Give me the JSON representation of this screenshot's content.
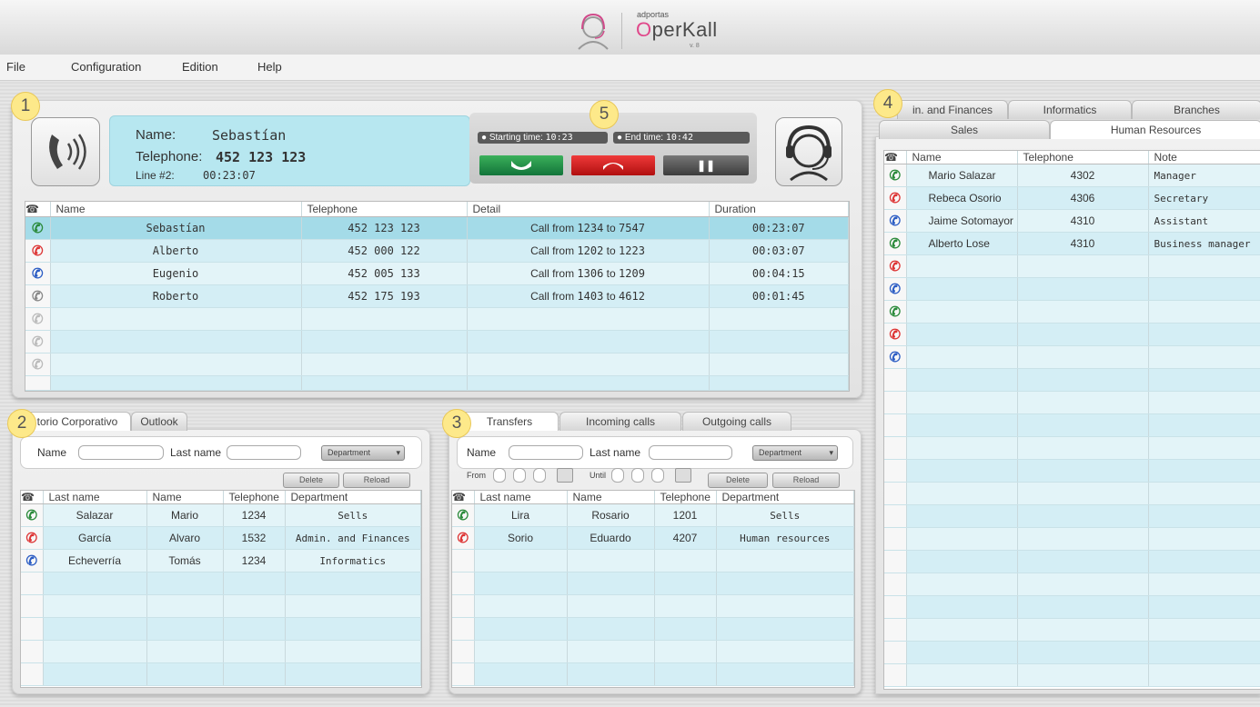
{
  "header": {
    "brand_small": "adportas",
    "brand_first": "O",
    "brand_rest": "perKall",
    "version": "v. 8"
  },
  "menu": [
    "File",
    "Configuration",
    "Edition",
    "Help"
  ],
  "badges": [
    "1",
    "2",
    "3",
    "4",
    "5"
  ],
  "call": {
    "name_label": "Name:",
    "name_value": "Sebastían",
    "phone_label": "Telephone:",
    "phone_value": "452 123 123",
    "line_label": "Line #2:",
    "line_time": "00:23:07",
    "start_label": "Starting time:",
    "start_value": "10:23",
    "end_label": "End time:",
    "end_value": "10:42"
  },
  "calls_table": {
    "headers": [
      "Name",
      "Telephone",
      "Detail",
      "Duration"
    ],
    "rows": [
      {
        "icon": "incoming-call-icon",
        "name": "Sebastían",
        "phone": "452 123 123",
        "detail": "Call from",
        "from": "1234",
        "to_label": "to",
        "to": "7547",
        "duration": "00:23:07"
      },
      {
        "icon": "outgoing-call-icon",
        "name": "Alberto",
        "phone": "452 000 122",
        "detail": "Call from",
        "from": "1202",
        "to_label": "to",
        "to": "1223",
        "duration": "00:03:07"
      },
      {
        "icon": "transfer-call-icon",
        "name": "Eugenio",
        "phone": "452 005 133",
        "detail": "Call from",
        "from": "1306",
        "to_label": "to",
        "to": "1209",
        "duration": "00:04:15"
      },
      {
        "icon": "hold-call-icon",
        "name": "Roberto",
        "phone": "452 175 193",
        "detail": "Call from",
        "from": "1403",
        "to_label": "to",
        "to": "4612",
        "duration": "00:01:45"
      }
    ]
  },
  "directory": {
    "tabs": [
      "torio Corporativo",
      "Outlook"
    ],
    "name_label": "Name",
    "lastname_label": "Last name",
    "department_label": "Department",
    "delete_label": "Delete",
    "reload_label": "Reload",
    "headers": [
      "Last name",
      "Name",
      "Telephone",
      "Department"
    ],
    "rows": [
      {
        "icon": "incoming-call-icon",
        "last": "Salazar",
        "name": "Mario",
        "phone": "1234",
        "dept": "Sells"
      },
      {
        "icon": "outgoing-call-icon",
        "last": "García",
        "name": "Alvaro",
        "phone": "1532",
        "dept": "Admin. and Finances"
      },
      {
        "icon": "transfer-call-icon",
        "last": "Echeverría",
        "name": "Tomás",
        "phone": "1234",
        "dept": "Informatics"
      }
    ]
  },
  "history": {
    "tabs": [
      "Transfers",
      "Incoming calls",
      "Outgoing calls"
    ],
    "name_label": "Name",
    "lastname_label": "Last name",
    "department_label": "Department",
    "from_label": "From",
    "until_label": "Until",
    "delete_label": "Delete",
    "reload_label": "Reload",
    "headers": [
      "Last name",
      "Name",
      "Telephone",
      "Department"
    ],
    "rows": [
      {
        "icon": "incoming-call-icon",
        "last": "Lira",
        "name": "Rosario",
        "phone": "1201",
        "dept": "Sells"
      },
      {
        "icon": "outgoing-call-icon",
        "last": "Sorio",
        "name": "Eduardo",
        "phone": "4207",
        "dept": "Human resources"
      }
    ]
  },
  "departments": {
    "tabs_back": [
      "in. and Finances",
      "Informatics",
      "Branches"
    ],
    "tabs_front": [
      "Sales",
      "Human Resources"
    ],
    "headers": [
      "Name",
      "Telephone",
      "Note"
    ],
    "rows": [
      {
        "icon": "incoming-call-icon",
        "name": "Mario Salazar",
        "phone": "4302",
        "note": "Manager"
      },
      {
        "icon": "outgoing-call-icon",
        "name": "Rebeca Osorio",
        "phone": "4306",
        "note": "Secretary"
      },
      {
        "icon": "transfer-call-icon",
        "name": "Jaime Sotomayor",
        "phone": "4310",
        "note": "Assistant"
      },
      {
        "icon": "incoming-call-icon",
        "name": "Alberto Lose",
        "phone": "4310",
        "note": "Business manager"
      }
    ]
  }
}
